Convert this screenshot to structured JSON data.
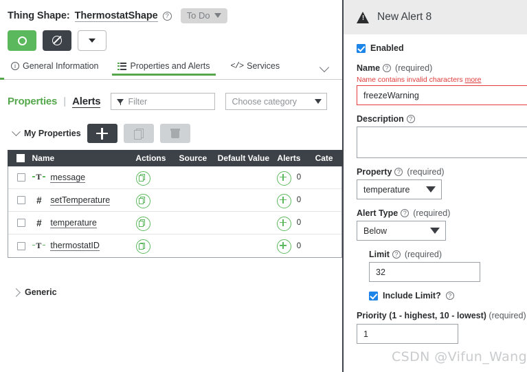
{
  "header": {
    "title_prefix": "Thing Shape:",
    "shape_name": "ThermostatShape",
    "help_icon": "?",
    "status_label": "To Do"
  },
  "action_buttons": [
    {
      "name": "save-button",
      "icon": "circle-icon"
    },
    {
      "name": "cancel-button",
      "icon": "ban-icon"
    },
    {
      "name": "more-actions-button",
      "icon": "caret-down-icon"
    }
  ],
  "tabs": [
    {
      "label": "General Information",
      "icon": "info-icon",
      "active": false
    },
    {
      "label": "Properties and Alerts",
      "icon": "list-icon",
      "active": true
    },
    {
      "label": "Services",
      "icon": "code-icon",
      "active": false
    }
  ],
  "subtabs": {
    "properties_label": "Properties",
    "divider": "|",
    "alerts_label": "Alerts"
  },
  "filters": {
    "filter_placeholder": "Filter",
    "filter_value": "",
    "category_placeholder": "Choose category",
    "category_value": ""
  },
  "group": {
    "my_properties_label": "My Properties",
    "add_label": "+",
    "duplicate_icon": "copy-icon",
    "delete_icon": "trash-icon"
  },
  "table": {
    "columns": [
      "",
      "Name",
      "Actions",
      "Source",
      "Default Value",
      "Alerts",
      "Cate"
    ],
    "rows": [
      {
        "type": "string",
        "type_glyph": "T",
        "name": "message",
        "source": "",
        "default_value": "",
        "alerts": "0",
        "category": ""
      },
      {
        "type": "number",
        "type_glyph": "#",
        "name": "setTemperature",
        "source": "",
        "default_value": "",
        "alerts": "0",
        "category": ""
      },
      {
        "type": "number",
        "type_glyph": "#",
        "name": "temperature",
        "source": "",
        "default_value": "",
        "alerts": "0",
        "category": ""
      },
      {
        "type": "string",
        "type_glyph": "T",
        "name": "thermostatID",
        "source": "",
        "default_value": "",
        "alerts": "0",
        "category": ""
      }
    ]
  },
  "generic_section": {
    "label": "Generic"
  },
  "panel": {
    "title": "New Alert 8",
    "warning_icon": "warning-triangle-icon",
    "enabled_label": "Enabled",
    "enabled_checked": true,
    "name_label": "Name",
    "name_required": "(required)",
    "name_error": "Name contains invalid characters",
    "name_error_link": "more",
    "name_value": "freezeWarning",
    "description_label": "Description",
    "description_value": "",
    "property_label": "Property",
    "property_required": "(required)",
    "property_value": "temperature",
    "alert_type_label": "Alert Type",
    "alert_type_required": "(required)",
    "alert_type_value": "Below",
    "limit_label": "Limit",
    "limit_required": "(required)",
    "limit_value": "32",
    "include_limit_label": "Include Limit?",
    "include_limit_checked": true,
    "priority_label_plain": "Priority (",
    "priority_label": "Priority (1 - highest, 10 - lowest)",
    "priority_required": "(required)",
    "priority_value": "1",
    "help_icon": "?"
  },
  "watermark": "CSDN @Vifun_Wang",
  "colors": {
    "accent_green": "#54a84b",
    "button_green": "#5cb85c",
    "dark": "#3c4248",
    "error_red": "#e03a3a",
    "checkbox_blue": "#1d85e8",
    "panel_head_bg": "#ebebeb"
  }
}
